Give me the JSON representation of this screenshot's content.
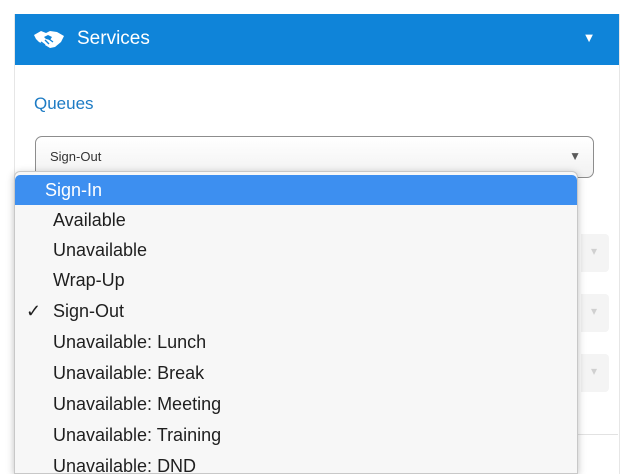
{
  "header": {
    "title": "Services",
    "icon": "handshake-icon",
    "toggle_icon": "caret-down-icon",
    "background": "#0f84d9"
  },
  "queues": {
    "label": "Queues",
    "selected_value": "Sign-Out",
    "arrow": "▼",
    "options": [
      {
        "label": "Sign-In",
        "highlighted": true,
        "checked": false
      },
      {
        "label": "Available",
        "highlighted": false,
        "checked": false
      },
      {
        "label": "Unavailable",
        "highlighted": false,
        "checked": false
      },
      {
        "label": "Wrap-Up",
        "highlighted": false,
        "checked": false
      },
      {
        "label": "Sign-Out",
        "highlighted": false,
        "checked": true,
        "check_mark": "✓"
      },
      {
        "label": "Unavailable: Lunch",
        "highlighted": false,
        "checked": false
      },
      {
        "label": "Unavailable: Break",
        "highlighted": false,
        "checked": false
      },
      {
        "label": "Unavailable: Meeting",
        "highlighted": false,
        "checked": false
      },
      {
        "label": "Unavailable: Training",
        "highlighted": false,
        "checked": false
      },
      {
        "label": "Unavailable: DND",
        "highlighted": false,
        "checked": false
      }
    ]
  },
  "colors": {
    "accent": "#1d7bc4",
    "highlight": "#3d8ff0"
  }
}
